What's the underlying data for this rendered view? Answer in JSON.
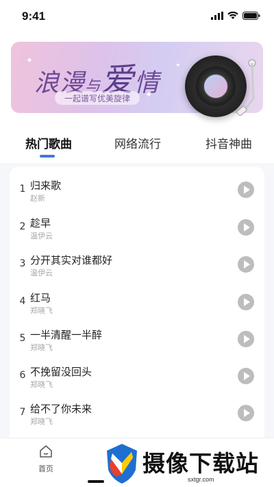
{
  "status_bar": {
    "time": "9:41"
  },
  "banner": {
    "title_start": "浪漫",
    "title_small": "与",
    "title_big": "爱",
    "title_end": "情",
    "subtitle": "一起谱写优美旋律"
  },
  "tabs": [
    {
      "label": "热门歌曲",
      "active": true
    },
    {
      "label": "网络流行",
      "active": false
    },
    {
      "label": "抖音神曲",
      "active": false
    }
  ],
  "songs": [
    {
      "rank": "1",
      "title": "归来歌",
      "artist": "赵新"
    },
    {
      "rank": "2",
      "title": "趁早",
      "artist": "温伊云"
    },
    {
      "rank": "3",
      "title": "分开其实对谁都好",
      "artist": "温伊云"
    },
    {
      "rank": "4",
      "title": "红马",
      "artist": "郑晓飞"
    },
    {
      "rank": "5",
      "title": "一半清醒一半醉",
      "artist": "郑晓飞"
    },
    {
      "rank": "6",
      "title": "不挽留没回头",
      "artist": "郑晓飞"
    },
    {
      "rank": "7",
      "title": "给不了你未来",
      "artist": "郑晓飞"
    }
  ],
  "bottom_nav": {
    "home_label": "首页"
  },
  "watermark": {
    "text": "摄像下载站",
    "url": "sxtgr.com"
  },
  "colors": {
    "accent": "#3e7ad8",
    "play_button": "#bdbdbd",
    "banner_title": "#6e4a97"
  }
}
